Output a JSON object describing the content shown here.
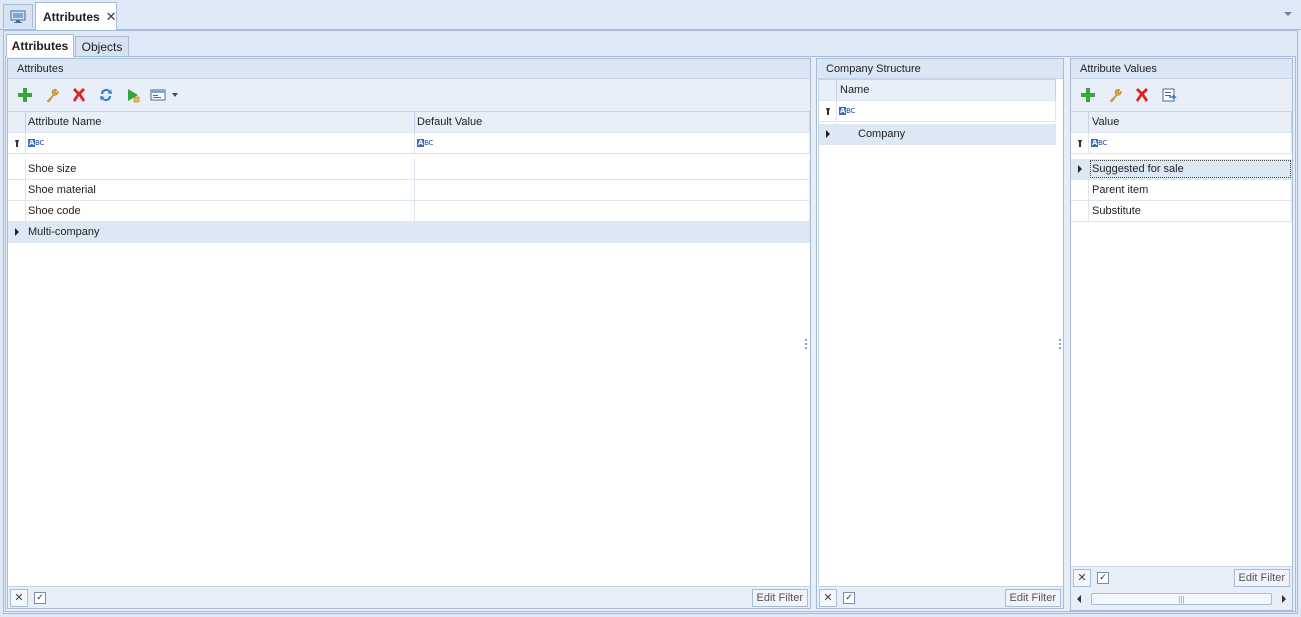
{
  "document_tab": {
    "title": "Attributes",
    "close_glyph": "✕"
  },
  "tabs": [
    {
      "label": "Attributes",
      "active": true
    },
    {
      "label": "Objects",
      "active": false
    }
  ],
  "attributes_panel": {
    "title": "Attributes",
    "columns": [
      "Attribute Name",
      "Default Value"
    ],
    "filter_placeholder": "ABC",
    "rows": [
      {
        "name": "Shoe size",
        "default": ""
      },
      {
        "name": "Shoe material",
        "default": ""
      },
      {
        "name": "Shoe code",
        "default": ""
      },
      {
        "name": "Multi-company",
        "default": ""
      }
    ],
    "edit_filter": "Edit Filter"
  },
  "company_panel": {
    "title": "Company Structure",
    "columns": [
      "Name"
    ],
    "rows": [
      {
        "name": "Company"
      }
    ],
    "edit_filter": "Edit Filter"
  },
  "values_panel": {
    "title": "Attribute Values",
    "columns": [
      "Value"
    ],
    "rows": [
      {
        "value": "Suggested for sale"
      },
      {
        "value": "Parent item"
      },
      {
        "value": "Substitute"
      }
    ],
    "edit_filter": "Edit Filter"
  },
  "colors": {
    "accent_green": "#3aa53a",
    "delete_red": "#e02020",
    "refresh_blue": "#2a7bd4"
  }
}
